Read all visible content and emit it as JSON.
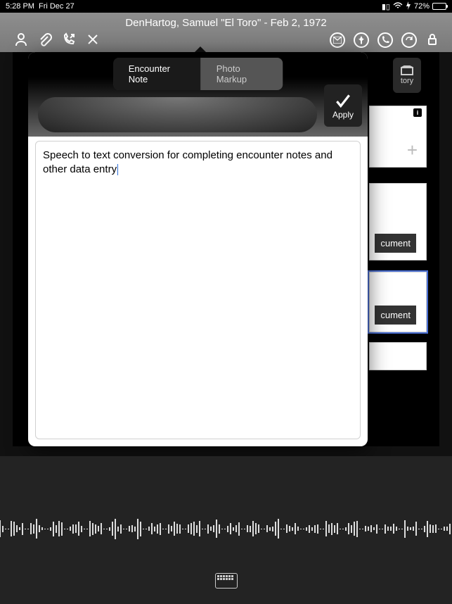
{
  "status": {
    "time": "5:28 PM",
    "date": "Fri Dec 27",
    "battery_pct": "72%"
  },
  "header": {
    "title": "DenHartog, Samuel \"El Toro\"  -  Feb 2, 1972"
  },
  "right_tab": {
    "label": "tory"
  },
  "cards": {
    "doc1": "cument",
    "doc2": "cument"
  },
  "popover": {
    "tabs": {
      "encounter": "Encounter Note",
      "photo": "Photo Markup"
    },
    "apply": "Apply",
    "note_text": "Speech to text conversion for completing encounter notes and other data entry"
  }
}
